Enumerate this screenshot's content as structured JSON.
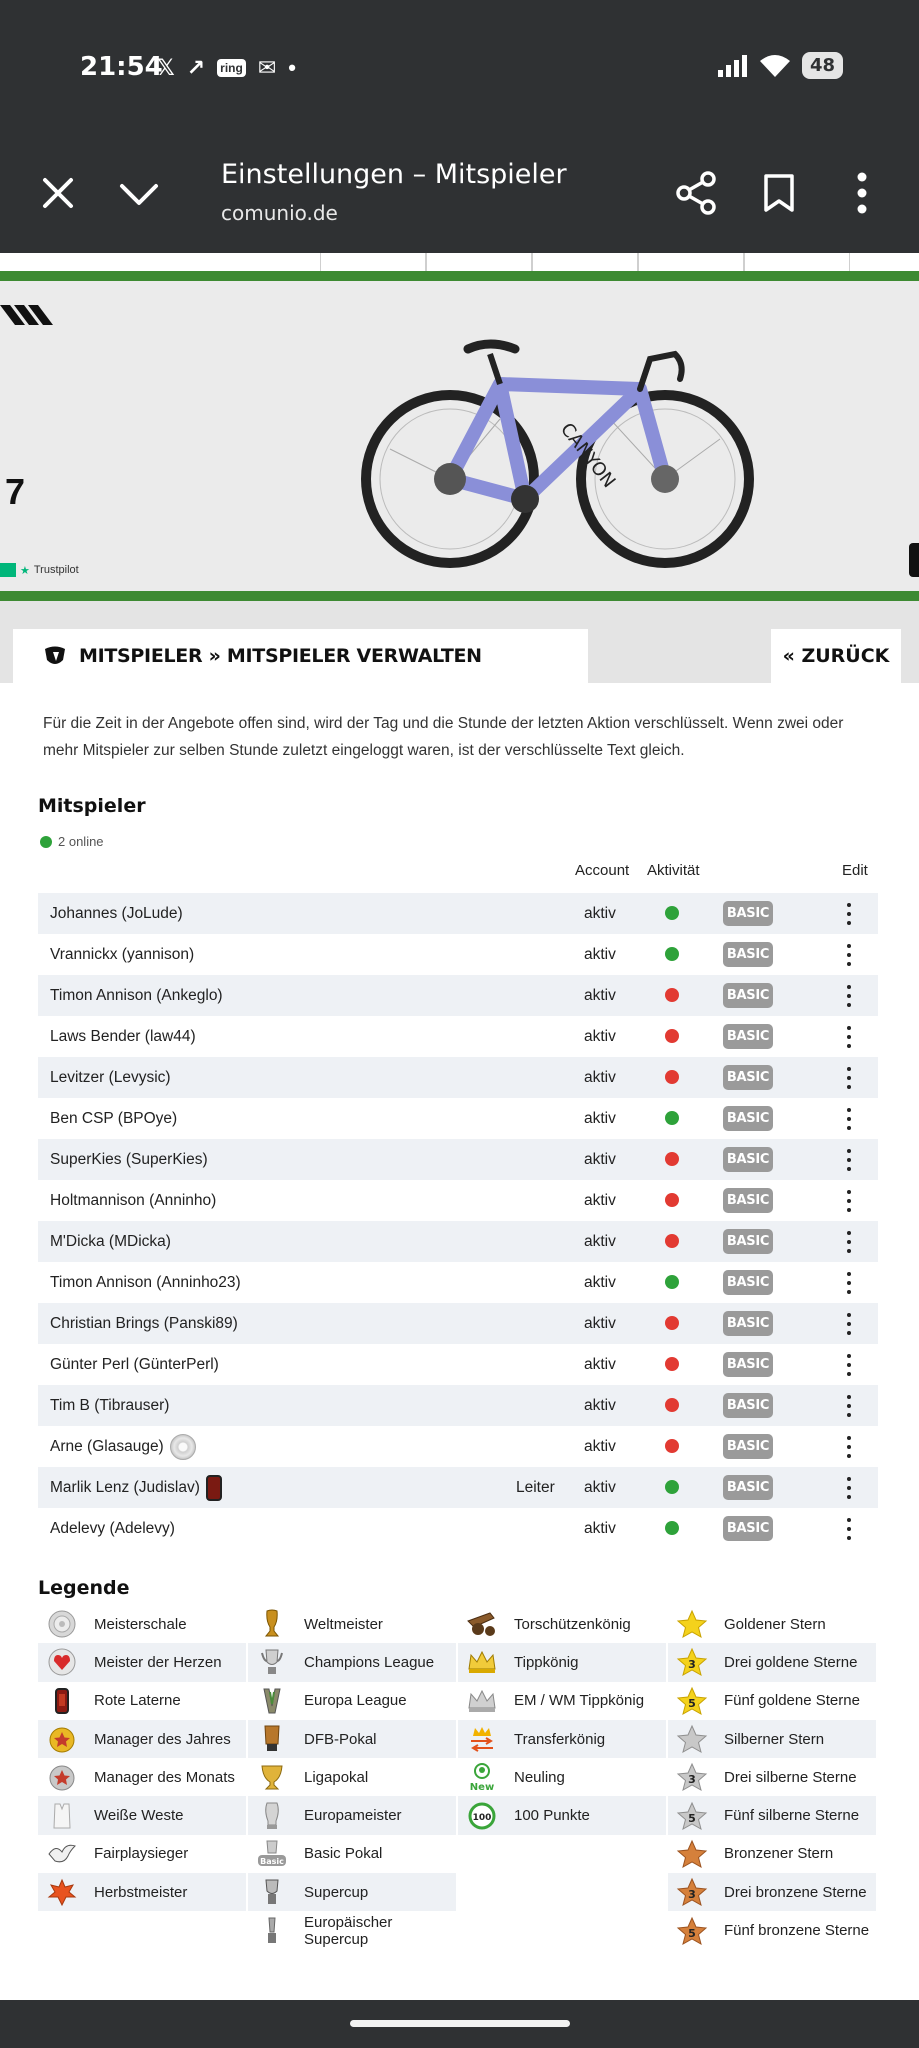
{
  "status_bar": {
    "time": "21:54",
    "notifications": [
      "X",
      "news",
      "ring",
      "mail",
      "•"
    ],
    "battery": "48"
  },
  "browser": {
    "title": "Einstellungen – Mitspieler",
    "domain": "comunio.de"
  },
  "ad": {
    "big_char": "7",
    "trustpilot": "Trustpilot"
  },
  "header": {
    "breadcrumb": "MITSPIELER » MITSPIELER VERWALTEN",
    "back_label": "« ZURÜCK"
  },
  "info_text": "Für die Zeit in der Angebote offen sind, wird der Tag und die Stunde der letzten Aktion verschlüsselt. Wenn zwei oder mehr Mitspieler zur selben Stunde zuletzt eingeloggt waren, ist der verschlüsselte Text gleich.",
  "players": {
    "title": "Mitspieler",
    "online_text": "2 online",
    "columns": {
      "account": "Account",
      "activity": "Aktivität",
      "edit": "Edit"
    },
    "rows": [
      {
        "name": "Johannes (JoLude)",
        "role": "",
        "account": "aktiv",
        "activity": "green",
        "plan": "BASIC",
        "badge": ""
      },
      {
        "name": "Vrannickx (yannison)",
        "role": "",
        "account": "aktiv",
        "activity": "green",
        "plan": "BASIC",
        "badge": ""
      },
      {
        "name": "Timon Annison (Ankeglo)",
        "role": "",
        "account": "aktiv",
        "activity": "red",
        "plan": "BASIC",
        "badge": ""
      },
      {
        "name": "Laws Bender (law44)",
        "role": "",
        "account": "aktiv",
        "activity": "red",
        "plan": "BASIC",
        "badge": ""
      },
      {
        "name": "Levitzer (Levysic)",
        "role": "",
        "account": "aktiv",
        "activity": "red",
        "plan": "BASIC",
        "badge": ""
      },
      {
        "name": "Ben CSP (BPOye)",
        "role": "",
        "account": "aktiv",
        "activity": "green",
        "plan": "BASIC",
        "badge": ""
      },
      {
        "name": "SuperKies (SuperKies)",
        "role": "",
        "account": "aktiv",
        "activity": "red",
        "plan": "BASIC",
        "badge": ""
      },
      {
        "name": "Holtmannison (Anninho)",
        "role": "",
        "account": "aktiv",
        "activity": "red",
        "plan": "BASIC",
        "badge": ""
      },
      {
        "name": "M'Dicka (MDicka)",
        "role": "",
        "account": "aktiv",
        "activity": "red",
        "plan": "BASIC",
        "badge": ""
      },
      {
        "name": "Timon Annison (Anninho23)",
        "role": "",
        "account": "aktiv",
        "activity": "green",
        "plan": "BASIC",
        "badge": ""
      },
      {
        "name": "Christian Brings (Panski89)",
        "role": "",
        "account": "aktiv",
        "activity": "red",
        "plan": "BASIC",
        "badge": ""
      },
      {
        "name": "Günter Perl (GünterPerl)",
        "role": "",
        "account": "aktiv",
        "activity": "red",
        "plan": "BASIC",
        "badge": ""
      },
      {
        "name": "Tim B (Tibrauser)",
        "role": "",
        "account": "aktiv",
        "activity": "red",
        "plan": "BASIC",
        "badge": ""
      },
      {
        "name": "Arne (Glasauge)",
        "role": "",
        "account": "aktiv",
        "activity": "red",
        "plan": "BASIC",
        "badge": "meisterschale-icon"
      },
      {
        "name": "Marlik Lenz (Judislav)",
        "role": "Leiter",
        "account": "aktiv",
        "activity": "green",
        "plan": "BASIC",
        "badge": "rote-laterne-icon"
      },
      {
        "name": "Adelevy (Adelevy)",
        "role": "",
        "account": "aktiv",
        "activity": "green",
        "plan": "BASIC",
        "badge": ""
      }
    ]
  },
  "legend": {
    "title": "Legende",
    "columns": [
      [
        {
          "label": "Meisterschale",
          "icon": "meisterschale-icon"
        },
        {
          "label": "Meister der Herzen",
          "icon": "heart-plate-icon"
        },
        {
          "label": "Rote Laterne",
          "icon": "rote-laterne-icon"
        },
        {
          "label": "Manager des Jahres",
          "icon": "gold-medal-star-icon"
        },
        {
          "label": "Manager des Monats",
          "icon": "silver-medal-star-icon"
        },
        {
          "label": "Weiße Weste",
          "icon": "white-vest-icon"
        },
        {
          "label": "Fairplaysieger",
          "icon": "dove-icon"
        },
        {
          "label": "Herbstmeister",
          "icon": "autumn-leaf-icon"
        }
      ],
      [
        {
          "label": "Weltmeister",
          "icon": "world-cup-trophy-icon"
        },
        {
          "label": "Champions League",
          "icon": "cl-trophy-icon"
        },
        {
          "label": "Europa League",
          "icon": "el-trophy-icon"
        },
        {
          "label": "DFB-Pokal",
          "icon": "dfb-pokal-icon"
        },
        {
          "label": "Ligapokal",
          "icon": "ligapokal-icon"
        },
        {
          "label": "Europameister",
          "icon": "euro-trophy-icon"
        },
        {
          "label": "Basic Pokal",
          "icon": "basic-pokal-icon"
        },
        {
          "label": "Supercup",
          "icon": "supercup-icon"
        },
        {
          "label": "Europäischer Supercup",
          "icon": "eu-supercup-icon"
        }
      ],
      [
        {
          "label": "Torschützenkönig",
          "icon": "cannon-icon"
        },
        {
          "label": "Tippkönig",
          "icon": "gold-crown-icon"
        },
        {
          "label": "EM / WM Tippkönig",
          "icon": "silver-crown-icon"
        },
        {
          "label": "Transferkönig",
          "icon": "transfer-crown-icon"
        },
        {
          "label": "Neuling",
          "icon": "new-user-icon"
        },
        {
          "label": "100 Punkte",
          "icon": "hundred-points-icon"
        }
      ],
      [
        {
          "label": "Goldener Stern",
          "icon": "gold-star-icon",
          "num": ""
        },
        {
          "label": "Drei goldene Sterne",
          "icon": "gold-star-3-icon",
          "num": "3"
        },
        {
          "label": "Fünf goldene Sterne",
          "icon": "gold-star-5-icon",
          "num": "5"
        },
        {
          "label": "Silberner Stern",
          "icon": "silver-star-icon",
          "num": ""
        },
        {
          "label": "Drei silberne Sterne",
          "icon": "silver-star-3-icon",
          "num": "3"
        },
        {
          "label": "Fünf silberne Sterne",
          "icon": "silver-star-5-icon",
          "num": "5"
        },
        {
          "label": "Bronzener Stern",
          "icon": "bronze-star-icon",
          "num": ""
        },
        {
          "label": "Drei bronzene Sterne",
          "icon": "bronze-star-3-icon",
          "num": "3"
        },
        {
          "label": "Fünf bronzene Sterne",
          "icon": "bronze-star-5-icon",
          "num": "5"
        }
      ]
    ]
  },
  "colors": {
    "online_green": "#2ea23a",
    "offline_red": "#e23a32",
    "basic_badge": "#9a9a9a",
    "site_green": "#3d8a32",
    "chrome_bar": "#2f3133"
  }
}
